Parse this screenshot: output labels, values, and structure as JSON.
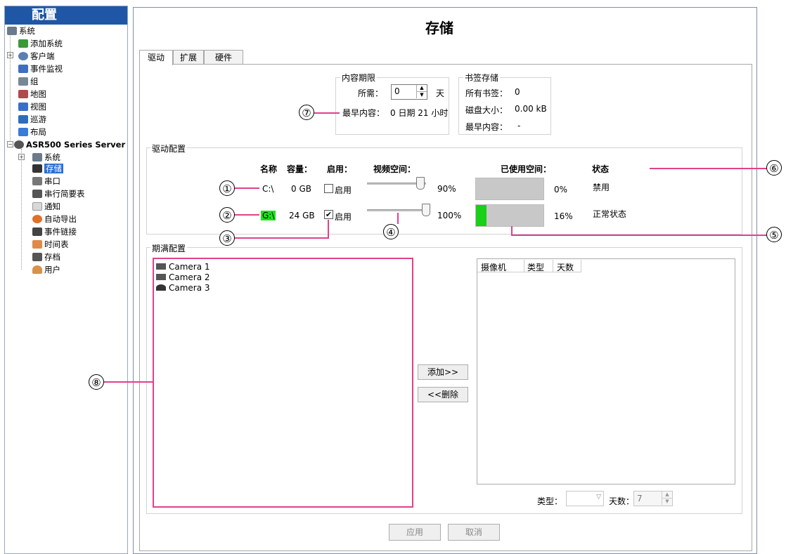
{
  "sidebar": {
    "title": "配置",
    "items": [
      {
        "label": "系统"
      },
      {
        "label": "添加系统"
      },
      {
        "label": "客户端"
      },
      {
        "label": "事件监视"
      },
      {
        "label": "组"
      },
      {
        "label": "地图"
      },
      {
        "label": "视图"
      },
      {
        "label": "巡游"
      },
      {
        "label": "布局"
      },
      {
        "label": "ASR500 Series Server"
      },
      {
        "label": "系统"
      },
      {
        "label": "存储"
      },
      {
        "label": "串口"
      },
      {
        "label": "串行简要表"
      },
      {
        "label": "通知"
      },
      {
        "label": "自动导出"
      },
      {
        "label": "事件链接"
      },
      {
        "label": "时间表"
      },
      {
        "label": "存档"
      },
      {
        "label": "用户"
      }
    ]
  },
  "page_title": "存储",
  "tabs": [
    {
      "label": "驱动"
    },
    {
      "label": "扩展"
    },
    {
      "label": "硬件"
    }
  ],
  "content_period": {
    "title": "内容期限",
    "required_label": "所需：",
    "required_value": "0",
    "unit": "天",
    "earliest_label": "最早内容：",
    "earliest_value": "0 日期 21 小时"
  },
  "bookmark_storage": {
    "title": "书签存储",
    "all_label": "所有书签：",
    "all_value": "0",
    "size_label": "磁盘大小：",
    "size_value": "0.00 kB",
    "earliest_label": "最早内容：",
    "earliest_value": "-"
  },
  "drive_config": {
    "title": "驱动配置",
    "headers": {
      "name": "名称",
      "capacity": "容量：",
      "enabled": "启用：",
      "video_space": "视频空间：",
      "used_space": "已使用空间：",
      "status": "状态"
    },
    "drives": [
      {
        "name": "C:\\",
        "capacity": "0 GB",
        "enabled": false,
        "enable_label": "启用",
        "video_pct": "90%",
        "video_frac": 0.9,
        "used_pct": "0%",
        "used_frac": 0.0,
        "status": "禁用"
      },
      {
        "name": "G:\\",
        "capacity": "24 GB",
        "enabled": true,
        "enable_label": "启用",
        "video_pct": "100%",
        "video_frac": 1.0,
        "used_pct": "16%",
        "used_frac": 0.16,
        "status": "正常状态"
      }
    ]
  },
  "expiry_config": {
    "title": "期满配置",
    "cameras": [
      {
        "name": "Camera 1"
      },
      {
        "name": "Camera 2"
      },
      {
        "name": "Camera 3"
      }
    ],
    "add_label": "添加>>",
    "remove_label": "<<删除",
    "columns": [
      "摄像机",
      "类型",
      "天数"
    ],
    "type_label": "类型：",
    "days_label": "天数：",
    "days_value": "7"
  },
  "footer": {
    "apply_label": "应用",
    "cancel_label": "取消"
  },
  "callouts": [
    "①",
    "②",
    "③",
    "④",
    "⑤",
    "⑥",
    "⑦",
    "⑧"
  ],
  "colors": {
    "accent": "#1f57a6",
    "callout_line": "#e0418c",
    "used_fill": "#18d018"
  }
}
